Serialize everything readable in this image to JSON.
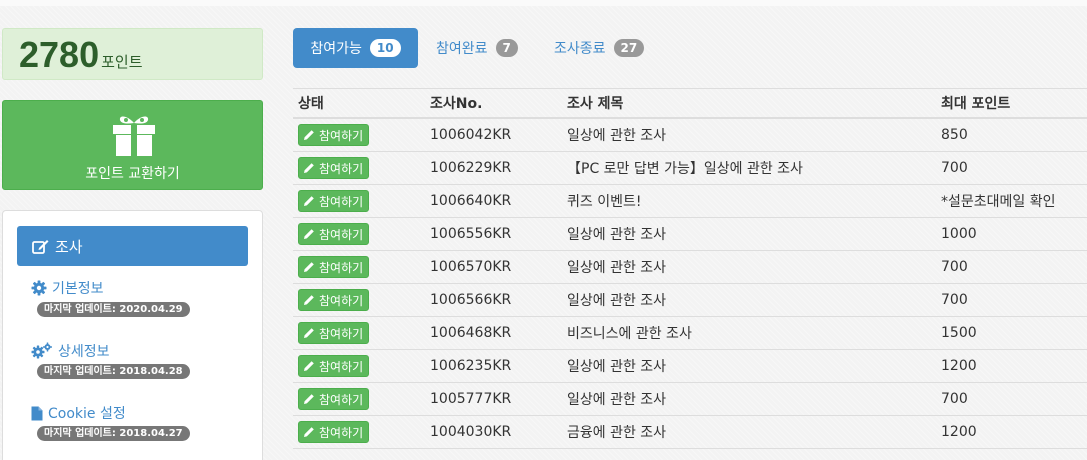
{
  "points": {
    "value": "2780",
    "unit": "포인트"
  },
  "exchange": {
    "label": "포인트 교환하기",
    "icon": "gift-icon"
  },
  "menu": {
    "active": {
      "label": "조사",
      "icon": "edit-icon"
    },
    "items": [
      {
        "label": "기본정보",
        "icon": "gear-icon",
        "updated": "마지막 업데이트: 2020.04.29"
      },
      {
        "label": "상세정보",
        "icon": "gears-icon",
        "updated": "마지막 업데이트: 2018.04.28"
      },
      {
        "label": "Cookie 설정",
        "icon": "file-icon",
        "updated": "마지막 업데이트: 2018.04.27"
      }
    ]
  },
  "tabs": [
    {
      "label": "참여가능",
      "count": "10"
    },
    {
      "label": "참여완료",
      "count": "7"
    },
    {
      "label": "조사종료",
      "count": "27"
    }
  ],
  "table": {
    "headers": [
      "상태",
      "조사No.",
      "조사 제목",
      "최대 포인트"
    ],
    "button_label": "참여하기",
    "rows": [
      {
        "no": "1006042KR",
        "title": "일상에 관한 조사",
        "points": "850"
      },
      {
        "no": "1006229KR",
        "title": "【PC 로만 답변 가능】일상에 관한 조사",
        "points": "700"
      },
      {
        "no": "1006640KR",
        "title": "퀴즈 이벤트!",
        "points": "*설문초대메일 확인"
      },
      {
        "no": "1006556KR",
        "title": "일상에 관한 조사",
        "points": "1000"
      },
      {
        "no": "1006570KR",
        "title": "일상에 관한 조사",
        "points": "700"
      },
      {
        "no": "1006566KR",
        "title": "일상에 관한 조사",
        "points": "700"
      },
      {
        "no": "1006468KR",
        "title": "비즈니스에 관한 조사",
        "points": "1500"
      },
      {
        "no": "1006235KR",
        "title": "일상에 관한 조사",
        "points": "1200"
      },
      {
        "no": "1005777KR",
        "title": "일상에 관한 조사",
        "points": "700"
      },
      {
        "no": "1004030KR",
        "title": "금융에 관한 조사",
        "points": "1200"
      }
    ]
  },
  "colors": {
    "primary": "#428bca",
    "success": "#5cb85c",
    "points_bg": "#dff0d8",
    "badge_gray": "#999999"
  }
}
